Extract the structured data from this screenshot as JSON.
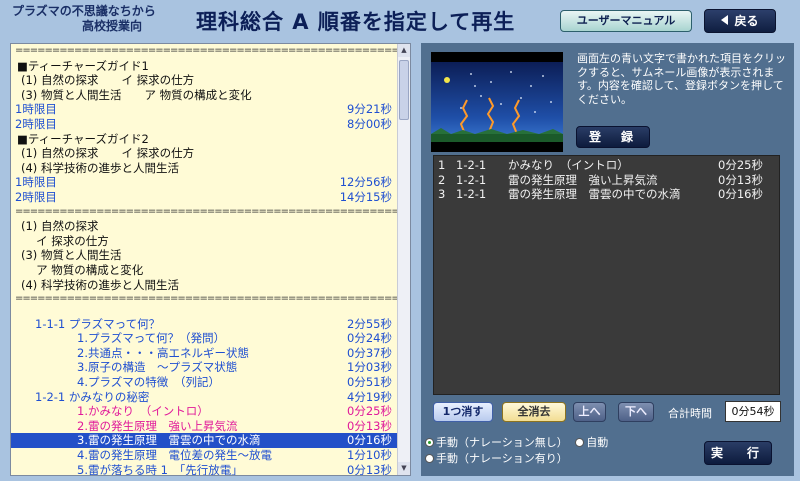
{
  "header": {
    "logo_line1": "プラズマの不思議なちから",
    "logo_line2": "高校授業向",
    "title": "理科総合 A 順番を指定して再生",
    "manual_label": "ユーザーマニュアル",
    "back_label": "戻る"
  },
  "left_list": {
    "separator": "===============================================================",
    "guide1": {
      "title": "■ティーチャーズガイド1",
      "lines": [
        "(1) 自然の探求　　イ 探求の仕方",
        "(3) 物質と人間生活　　ア 物質の構成と変化"
      ],
      "periods": [
        {
          "label": "1時限目",
          "duration": "9分21秒"
        },
        {
          "label": "2時限目",
          "duration": "8分00秒"
        }
      ]
    },
    "guide2": {
      "title": "■ティーチャーズガイド2",
      "lines": [
        "(1) 自然の探求　　イ 探求の仕方",
        "(4) 科学技術の進歩と人間生活"
      ],
      "periods": [
        {
          "label": "1時限目",
          "duration": "12分56秒"
        },
        {
          "label": "2時限目",
          "duration": "14分15秒"
        }
      ]
    },
    "topics": [
      "(1) 自然の探求",
      "　 イ 探求の仕方",
      "(3) 物質と人間生活",
      "　 ア 物質の構成と変化",
      "(4) 科学技術の進歩と人間生活"
    ],
    "items": [
      {
        "text": "1-1-1 プラズマって何？",
        "duration": "2分55秒",
        "level": 1,
        "style": "blue"
      },
      {
        "text": "1.プラズマって何？（発問）",
        "duration": "0分24秒",
        "level": 2,
        "style": "blue"
      },
      {
        "text": "2.共通点・・・高エネルギー状態",
        "duration": "0分37秒",
        "level": 2,
        "style": "blue"
      },
      {
        "text": "3.原子の構造　～プラズマ状態",
        "duration": "1分03秒",
        "level": 2,
        "style": "blue"
      },
      {
        "text": "4.プラズマの特徴　（列記）",
        "duration": "0分51秒",
        "level": 2,
        "style": "blue"
      },
      {
        "text": "1-2-1 かみなりの秘密",
        "duration": "4分19秒",
        "level": 1,
        "style": "blue"
      },
      {
        "text": "1.かみなり　（イントロ）",
        "duration": "0分25秒",
        "level": 2,
        "style": "pink"
      },
      {
        "text": "2.雷の発生原理　強い上昇気流",
        "duration": "0分13秒",
        "level": 2,
        "style": "pink"
      },
      {
        "text": "3.雷の発生原理　雷雲の中での水滴",
        "duration": "0分16秒",
        "level": 2,
        "style": "sel"
      },
      {
        "text": "4.雷の発生原理　電位差の発生～放電",
        "duration": "1分10秒",
        "level": 2,
        "style": "blue"
      },
      {
        "text": "5.雷が落ちる時 1　「先行放電」",
        "duration": "0分13秒",
        "level": 2,
        "style": "blue"
      }
    ]
  },
  "right_panel": {
    "description": "画面左の青い文字で書かれた項目をクリックすると、サムネール画像が表示されます。内容を確認して、登録ボタンを押してください。",
    "register_label": "登　録",
    "playlist": [
      {
        "no": "1",
        "code": "1-2-1",
        "title": "かみなり　（イントロ）",
        "duration": "0分25秒"
      },
      {
        "no": "2",
        "code": "1-2-1",
        "title": "雷の発生原理　強い上昇気流",
        "duration": "0分13秒"
      },
      {
        "no": "3",
        "code": "1-2-1",
        "title": "雷の発生原理　雷雲の中での水滴",
        "duration": "0分16秒"
      }
    ],
    "delete_one_label": "1つ消す",
    "delete_all_label": "全消去",
    "up_label": "上へ",
    "down_label": "下へ",
    "total_label": "合計時間",
    "total_value": "0分54秒",
    "mode_manual_no_narration": "手動（ナレーション無し）",
    "mode_auto": "自動",
    "mode_manual_narration": "手動（ナレーション有り）",
    "selected_mode": "手動（ナレーション無し）",
    "run_label": "実　行"
  },
  "colors": {
    "background": "#a9c3e0",
    "list_bg": "#fffbd6",
    "link_blue": "#1f4fd1",
    "registered_pink": "#e0199a",
    "selection": "#2350c8",
    "right_panel": "#516f8f"
  }
}
